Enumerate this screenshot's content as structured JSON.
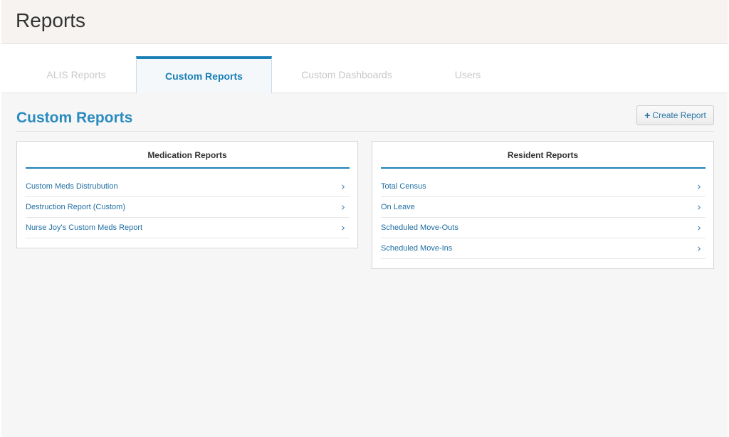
{
  "header": {
    "title": "Reports"
  },
  "tabs": [
    {
      "label": "ALIS Reports",
      "active": false
    },
    {
      "label": "Custom Reports",
      "active": true
    },
    {
      "label": "Custom Dashboards",
      "active": false
    },
    {
      "label": "Users",
      "active": false
    }
  ],
  "main": {
    "section_title": "Custom Reports",
    "create_button": {
      "icon": "plus-icon",
      "label": "Create Report"
    }
  },
  "cards": {
    "medication": {
      "title": "Medication Reports",
      "items": [
        {
          "label": "Custom Meds Distrubution"
        },
        {
          "label": "Destruction Report (Custom)"
        },
        {
          "label": "Nurse Joy's Custom Meds Report"
        }
      ]
    },
    "resident": {
      "title": "Resident Reports",
      "items": [
        {
          "label": "Total Census"
        },
        {
          "label": "On Leave"
        },
        {
          "label": "Scheduled Move-Outs"
        },
        {
          "label": "Scheduled Move-Ins"
        }
      ]
    }
  },
  "colors": {
    "accent": "#1a80b6",
    "link": "#1f6fa3",
    "inactive_tab": "#c8c8c8"
  }
}
